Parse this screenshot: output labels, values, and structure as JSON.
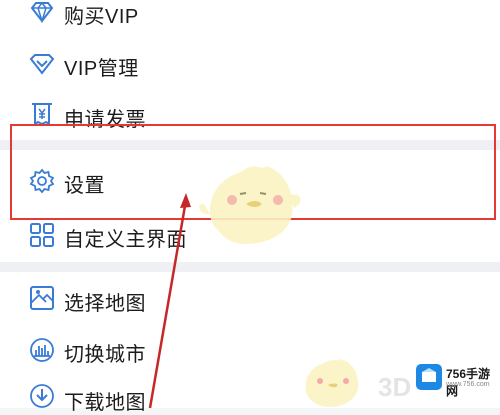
{
  "menu": {
    "items": [
      {
        "label": "购买VIP",
        "icon": "diamond-icon"
      },
      {
        "label": "VIP管理",
        "icon": "vip-shield-icon"
      },
      {
        "label": "申请发票",
        "icon": "invoice-icon"
      },
      {
        "label": "设置",
        "icon": "gear-icon"
      },
      {
        "label": "自定义主界面",
        "icon": "grid-icon"
      },
      {
        "label": "选择地图",
        "icon": "map-icon"
      },
      {
        "label": "切换城市",
        "icon": "city-icon"
      },
      {
        "label": "下载地图",
        "icon": "download-icon"
      }
    ]
  },
  "watermark": {
    "brand": "756手游网",
    "sub": "www.756.com",
    "overlay": "3D"
  },
  "colors": {
    "accent": "#3a7bd5",
    "highlight": "#e53935",
    "text": "#1c1c1e",
    "background": "#f4f5f7"
  }
}
